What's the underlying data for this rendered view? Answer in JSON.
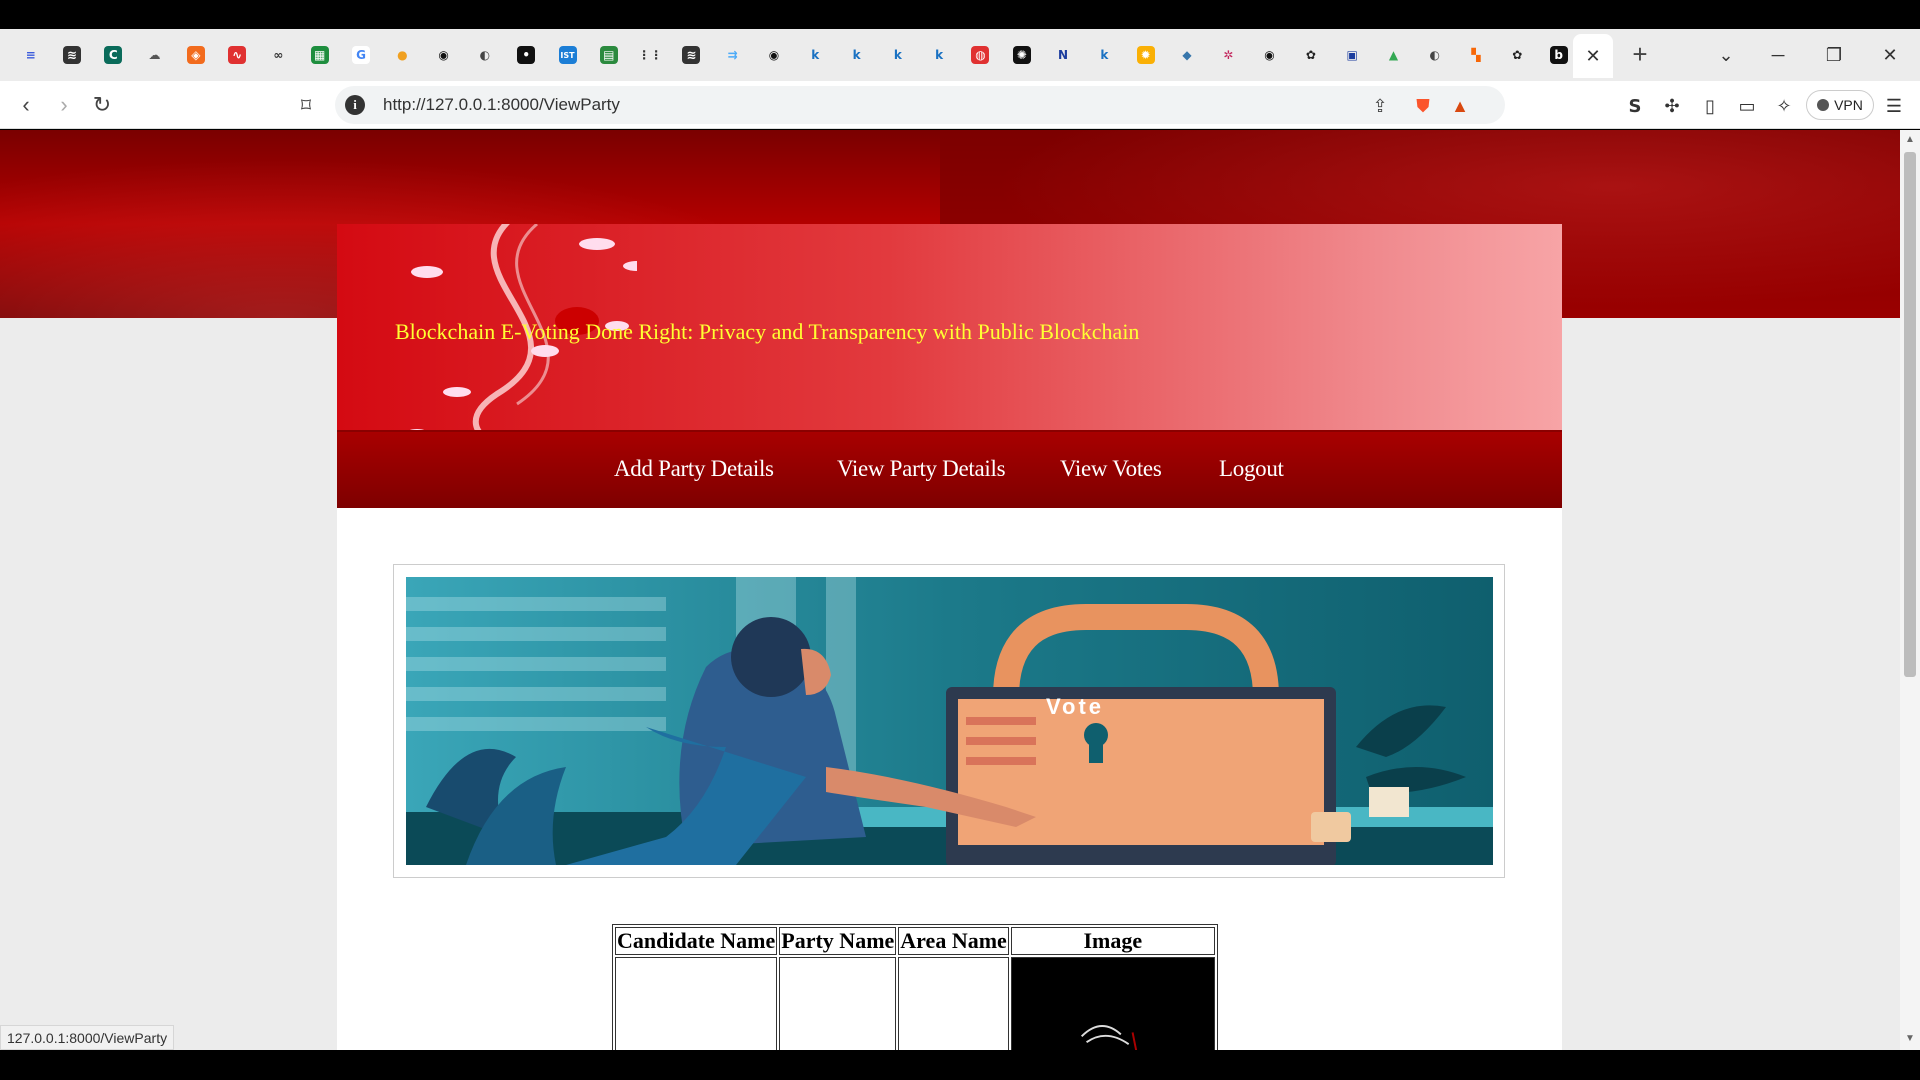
{
  "browser": {
    "tabs": [
      {
        "icon": "menu-lines-icon",
        "bg": "#ececec",
        "fg": "#3b5bdb",
        "glyph": "≡"
      },
      {
        "icon": "text-icon",
        "bg": "#333333",
        "fg": "#ffffff",
        "glyph": "≋"
      },
      {
        "icon": "c-logo-icon",
        "bg": "#0a6b5a",
        "fg": "#ffffff",
        "glyph": "C"
      },
      {
        "icon": "cloud-icon",
        "bg": "#ececec",
        "fg": "#555555",
        "glyph": "☁"
      },
      {
        "icon": "shield-orange-icon",
        "bg": "#f26b1d",
        "fg": "#ffffff",
        "glyph": "◈"
      },
      {
        "icon": "scribble-icon",
        "bg": "#e03131",
        "fg": "#ffffff",
        "glyph": "∿"
      },
      {
        "icon": "glasses-icon",
        "bg": "#ececec",
        "fg": "#333333",
        "glyph": "∞"
      },
      {
        "icon": "sheet-icon",
        "bg": "#1e8e3e",
        "fg": "#ffffff",
        "glyph": "▦"
      },
      {
        "icon": "google-icon",
        "bg": "#ffffff",
        "fg": "#4285f4",
        "glyph": "G"
      },
      {
        "icon": "person-icon",
        "bg": "#ececec",
        "fg": "#f0a020",
        "glyph": "●"
      },
      {
        "icon": "github-icon",
        "bg": "#ececec",
        "fg": "#111111",
        "glyph": "◉"
      },
      {
        "icon": "globe-icon",
        "bg": "#ececec",
        "fg": "#444444",
        "glyph": "◐"
      },
      {
        "icon": "dark-circle-icon",
        "bg": "#111111",
        "fg": "#ffffff",
        "glyph": "•"
      },
      {
        "icon": "ist-icon",
        "bg": "#1c7ed6",
        "fg": "#ffffff",
        "glyph": "IST"
      },
      {
        "icon": "sheet-green-icon",
        "bg": "#2b8a3e",
        "fg": "#ffffff",
        "glyph": "▤"
      },
      {
        "icon": "cisco-icon",
        "bg": "#ececec",
        "fg": "#333333",
        "glyph": "⋮⋮"
      },
      {
        "icon": "text-dark-icon",
        "bg": "#333333",
        "fg": "#ffffff",
        "glyph": "≋"
      },
      {
        "icon": "arrows-icon",
        "bg": "#ececec",
        "fg": "#4dabf7",
        "glyph": "⇉"
      },
      {
        "icon": "github-icon",
        "bg": "#ececec",
        "fg": "#111111",
        "glyph": "◉"
      },
      {
        "icon": "k-icon",
        "bg": "#ececec",
        "fg": "#1971c2",
        "glyph": "k"
      },
      {
        "icon": "k-icon",
        "bg": "#ececec",
        "fg": "#1971c2",
        "glyph": "k"
      },
      {
        "icon": "k-icon",
        "bg": "#ececec",
        "fg": "#1971c2",
        "glyph": "k"
      },
      {
        "icon": "k-icon",
        "bg": "#ececec",
        "fg": "#1971c2",
        "glyph": "k"
      },
      {
        "icon": "record-icon",
        "bg": "#e03131",
        "fg": "#ffffff",
        "glyph": "◍"
      },
      {
        "icon": "chatgpt-icon",
        "bg": "#111111",
        "fg": "#ffffff",
        "glyph": "✺"
      },
      {
        "icon": "n-logo-icon",
        "bg": "#ececec",
        "fg": "#1c3d9e",
        "glyph": "N"
      },
      {
        "icon": "k-icon",
        "bg": "#ececec",
        "fg": "#1971c2",
        "glyph": "k"
      },
      {
        "icon": "sun-icon",
        "bg": "#fab005",
        "fg": "#ffffff",
        "glyph": "✹"
      },
      {
        "icon": "python-icon",
        "bg": "#ececec",
        "fg": "#3776ab",
        "glyph": "◆"
      },
      {
        "icon": "gear-color-icon",
        "bg": "#ececec",
        "fg": "#c2255c",
        "glyph": "✲"
      },
      {
        "icon": "github-icon",
        "bg": "#ececec",
        "fg": "#111111",
        "glyph": "◉"
      },
      {
        "icon": "openai-icon",
        "bg": "#ececec",
        "fg": "#222222",
        "glyph": "✿"
      },
      {
        "icon": "layout-icon",
        "bg": "#ececec",
        "fg": "#1c3d9e",
        "glyph": "▣"
      },
      {
        "icon": "drive-icon",
        "bg": "#ececec",
        "fg": "#34a853",
        "glyph": "▲"
      },
      {
        "icon": "globe-icon",
        "bg": "#ececec",
        "fg": "#444444",
        "glyph": "◐"
      },
      {
        "icon": "colorful-icon",
        "bg": "#ececec",
        "fg": "#f76707",
        "glyph": "▚"
      },
      {
        "icon": "openai-icon",
        "bg": "#ececec",
        "fg": "#222222",
        "glyph": "✿"
      },
      {
        "icon": "b-logo-icon",
        "bg": "#111111",
        "fg": "#ffffff",
        "glyph": "b"
      }
    ],
    "active_tab_close": "✕",
    "new_tab": "+",
    "url": "http://127.0.0.1:8000/ViewParty",
    "status_url": "127.0.0.1:8000/ViewParty",
    "vpn_label": "VPN"
  },
  "page": {
    "banner_title": "Blockchain E-Voting Done Right: Privacy and Transparency with Public Blockchain",
    "nav": [
      {
        "label": "Add Party Details"
      },
      {
        "label": "View Party Details"
      },
      {
        "label": "View Votes"
      },
      {
        "label": "Logout"
      }
    ],
    "illustration_text": "Vote",
    "table": {
      "headers": [
        "Candidate Name",
        "Party Name",
        "Area Name",
        "Image"
      ]
    }
  },
  "colors": {
    "banner_title": "#ffff33",
    "nav_bg": "#8f0000",
    "hero_bg": "#a00000"
  }
}
